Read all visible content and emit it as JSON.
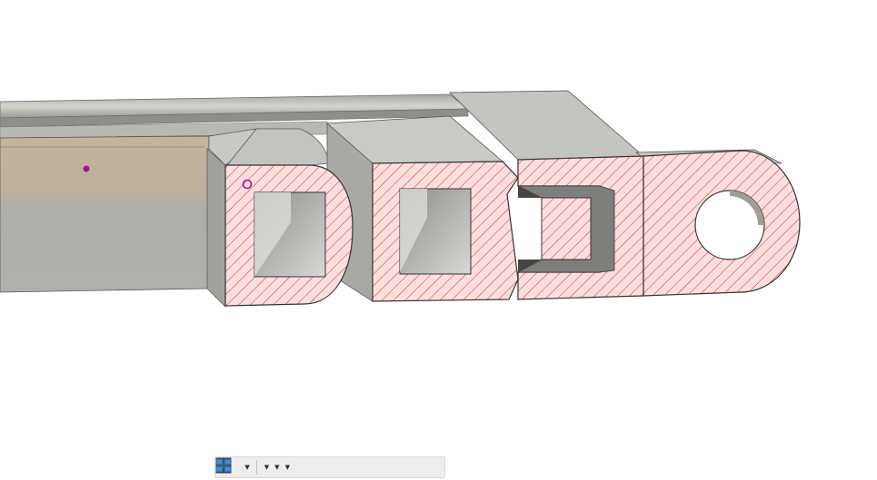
{
  "app": {
    "view": "section-analysis-3d-viewport"
  },
  "colors": {
    "section_fill": "#ffdede",
    "hatch": "#d02828",
    "body_face": "#c6c6c2",
    "body_top": "#c2c6bf",
    "body_dark": "#9a9a96",
    "bar_front": "#bcb3a4",
    "sketch_point": "#9b1a8a",
    "toolbar_bg": "#ededed"
  },
  "navigation_toolbar": {
    "items": [
      {
        "name": "orbit-icon",
        "has_dropdown": true
      },
      {
        "name": "look-at-icon",
        "has_dropdown": false
      },
      {
        "name": "pan-icon",
        "has_dropdown": false
      },
      {
        "name": "zoom-icon",
        "has_dropdown": false
      },
      {
        "name": "zoom-window-icon",
        "has_dropdown": true
      },
      {
        "name": "display-settings-icon",
        "has_dropdown": true
      },
      {
        "name": "grid-snaps-icon",
        "has_dropdown": true
      },
      {
        "name": "viewports-icon",
        "has_dropdown": true
      }
    ]
  }
}
